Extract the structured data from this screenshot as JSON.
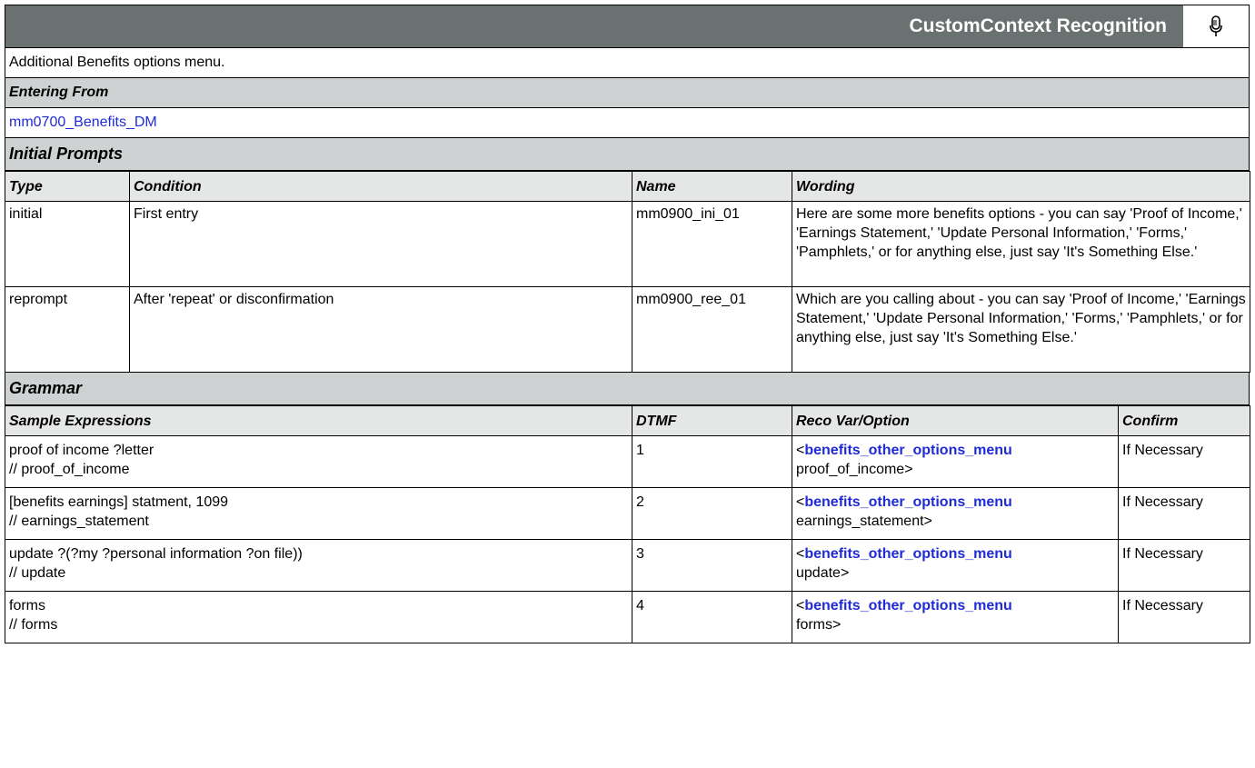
{
  "header": {
    "title": "CustomContext Recognition",
    "icon": "microphone-icon"
  },
  "description": "Additional Benefits options menu.",
  "entering_from": {
    "label": "Entering From",
    "link": "mm0700_Benefits_DM"
  },
  "initial_prompts": {
    "label": "Initial Prompts",
    "columns": [
      "Type",
      "Condition",
      "Name",
      "Wording"
    ],
    "rows": [
      {
        "type": "initial",
        "condition": "First entry",
        "name": "mm0900_ini_01",
        "wording": "Here are some more benefits options - you can say 'Proof of Income,' 'Earnings Statement,' 'Update Personal Information,' 'Forms,' 'Pamphlets,' or for anything else, just say 'It's Something Else.'"
      },
      {
        "type": "reprompt",
        "condition": "After 'repeat' or disconfirmation",
        "name": "mm0900_ree_01",
        "wording": "Which are you calling about - you can say 'Proof of Income,' 'Earnings Statement,' 'Update Personal Information,' 'Forms,' 'Pamphlets,' or for anything else, just say 'It's Something Else.'"
      }
    ]
  },
  "grammar": {
    "label": "Grammar",
    "columns": [
      "Sample Expressions",
      "DTMF",
      "Reco Var/Option",
      "Confirm"
    ],
    "rows": [
      {
        "expr": "proof of income ?letter",
        "comment": "// proof_of_income",
        "dtmf": "1",
        "reco_open": "<",
        "reco_var": "benefits_other_options_menu",
        "reco_value": "proof_of_income>",
        "confirm": "If Necessary"
      },
      {
        "expr": "[benefits earnings] statment, 1099",
        "comment": "// earnings_statement",
        "dtmf": "2",
        "reco_open": "<",
        "reco_var": "benefits_other_options_menu",
        "reco_value": "earnings_statement>",
        "confirm": "If Necessary"
      },
      {
        "expr": "update ?(?my ?personal information ?on file))",
        "comment": "// update",
        "dtmf": "3",
        "reco_open": "<",
        "reco_var": "benefits_other_options_menu",
        "reco_value": "update>",
        "confirm": "If Necessary"
      },
      {
        "expr": "forms",
        "comment": "// forms",
        "dtmf": "4",
        "reco_open": "<",
        "reco_var": "benefits_other_options_menu",
        "reco_value": "forms>",
        "confirm": "If Necessary"
      }
    ]
  }
}
